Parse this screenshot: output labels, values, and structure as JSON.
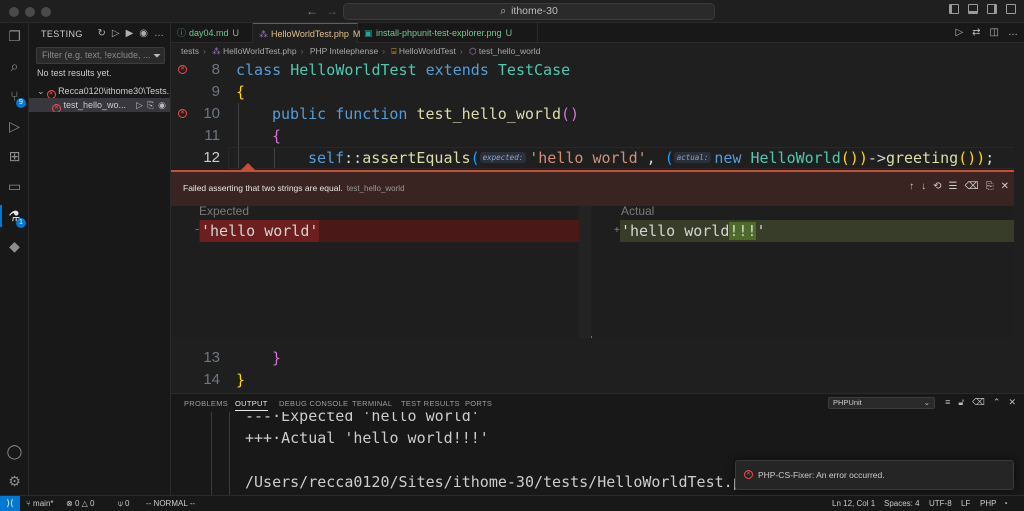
{
  "titlebar": {
    "search_text": "ithome-30",
    "back_icon": "arrow-left",
    "forward_icon": "arrow-right"
  },
  "sidebar": {
    "title": "TESTING",
    "filter_placeholder": "Filter (e.g. text, !exclude, ...",
    "no_results": "No test results yet.",
    "tree": [
      {
        "label": "Recca0120\\ithome30\\Tests...",
        "status": "failed"
      },
      {
        "label": "test_hello_wo...",
        "status": "failed"
      }
    ]
  },
  "tabs": [
    {
      "label": "day04.md",
      "mark": "U",
      "color": "#73c991"
    },
    {
      "label": "HelloWorldTest.php",
      "mark": "M",
      "color": "#e2c08d"
    },
    {
      "label": "install-phpunit-test-explorer.png",
      "mark": "U",
      "color": "#73c991"
    }
  ],
  "breadcrumb": [
    "tests",
    "HelloWorldTest.php",
    "PHP Intelephense",
    "HelloWorldTest",
    "test_hello_world"
  ],
  "editor": {
    "lines": {
      "l8": "8",
      "l9": "9",
      "l10": "10",
      "l11": "11",
      "l12": "12",
      "l13": "13",
      "l14": "14"
    },
    "code": {
      "class_kw": "class",
      "class_name": "HelloWorldTest",
      "extends_kw": "extends",
      "parent": "TestCase",
      "open_brace": "{",
      "public_kw": "public",
      "function_kw": "function",
      "method": "test_hello_world",
      "parens": "()",
      "self_kw": "self",
      "sep": "::",
      "assert": "assertEquals",
      "hint_expected": "expected:",
      "hint_actual": "actual:",
      "string": "'hello world'",
      "new_kw": "new",
      "hw": "HelloWorld",
      "arrow": "->",
      "greeting": "greeting",
      "close_brace": "}"
    }
  },
  "peek": {
    "message": "Failed asserting that two strings are equal.",
    "test_name": "test_hello_world",
    "expected_label": "Expected",
    "actual_label": "Actual",
    "expected_value": "'hello world'",
    "actual_value": "'hello world!!!'",
    "actual_prefix": "'hello world",
    "actual_suffix": "!!!",
    "actual_quote": "'"
  },
  "panel": {
    "tabs": [
      "PROBLEMS",
      "OUTPUT",
      "DEBUG CONSOLE",
      "TERMINAL",
      "TEST RESULTS",
      "PORTS"
    ],
    "active_tab": "OUTPUT",
    "channel": "PHPUnit",
    "output_lines": [
      "---·Expected 'hello world'",
      "+++·Actual 'hello world!!!'",
      "/Users/recca0120/Sites/ithome-30/tests/HelloWorldTest.p"
    ]
  },
  "toast": {
    "message": "PHP-CS-Fixer: An error occurred."
  },
  "statusbar": {
    "branch": "main*",
    "errors": "0",
    "warnings": "0",
    "ports": "0",
    "mode": "-- NORMAL --",
    "position": "Ln 12, Col 1",
    "spaces": "Spaces: 4",
    "encoding": "UTF-8",
    "eol": "LF",
    "language": "PHP"
  },
  "colors": {
    "accent": "#0078d4",
    "error": "#f14c4c",
    "removed_bg": "#4b1818",
    "added_bg": "#373d29"
  }
}
